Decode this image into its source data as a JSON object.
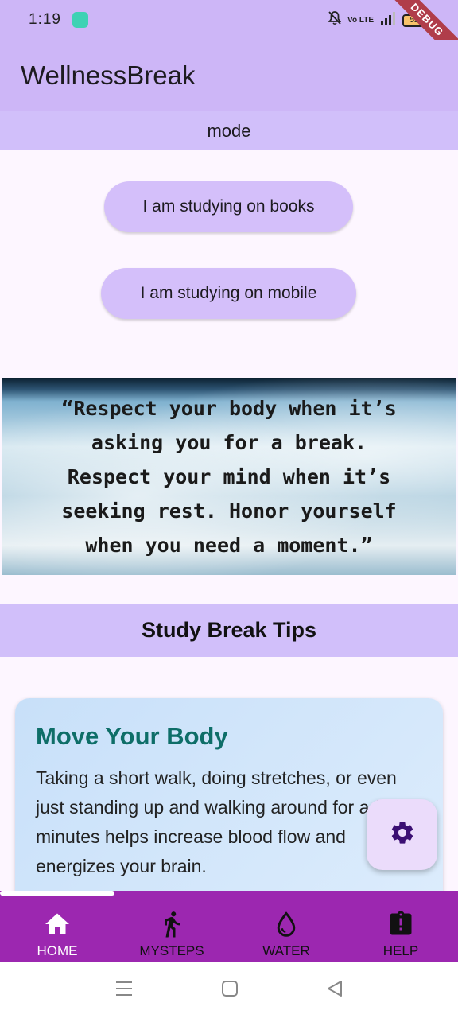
{
  "status_bar": {
    "time": "1:19",
    "network": "Vo LTE",
    "battery": "52"
  },
  "debug_banner": "DEBUG",
  "app_bar": {
    "title": "WellnessBreak"
  },
  "mode_bar": {
    "label": "mode"
  },
  "buttons": {
    "books": "I am studying on books",
    "mobile": "I am studying on mobile"
  },
  "quote_image": {
    "lines": [
      "“Respect your body when it’s",
      "asking you for a break.",
      "Respect your mind when it’s",
      "seeking rest. Honor yourself",
      "when you need a moment.”"
    ]
  },
  "tips": {
    "header": "Study Break Tips",
    "card": {
      "heading": "Move Your Body",
      "body": "Taking a short walk, doing stretches, or even just standing up and walking around for a few minutes helps increase blood flow and energizes your brain."
    }
  },
  "fab": {
    "icon": "settings-icon"
  },
  "bottom_nav": {
    "items": [
      {
        "label": "HOME",
        "icon": "home-icon",
        "active": true
      },
      {
        "label": "MYSTEPS",
        "icon": "walking-icon",
        "active": false
      },
      {
        "label": "WATER",
        "icon": "water-drop-icon",
        "active": false
      },
      {
        "label": "HELP",
        "icon": "help-clipboard-icon",
        "active": false
      }
    ]
  },
  "colors": {
    "app_bar": "#cdb6f7",
    "accent_bar": "#d1bffa",
    "nav_bar": "#9c27b0",
    "tip_heading": "#0e6e68",
    "card_bg": "#dcecfc"
  }
}
